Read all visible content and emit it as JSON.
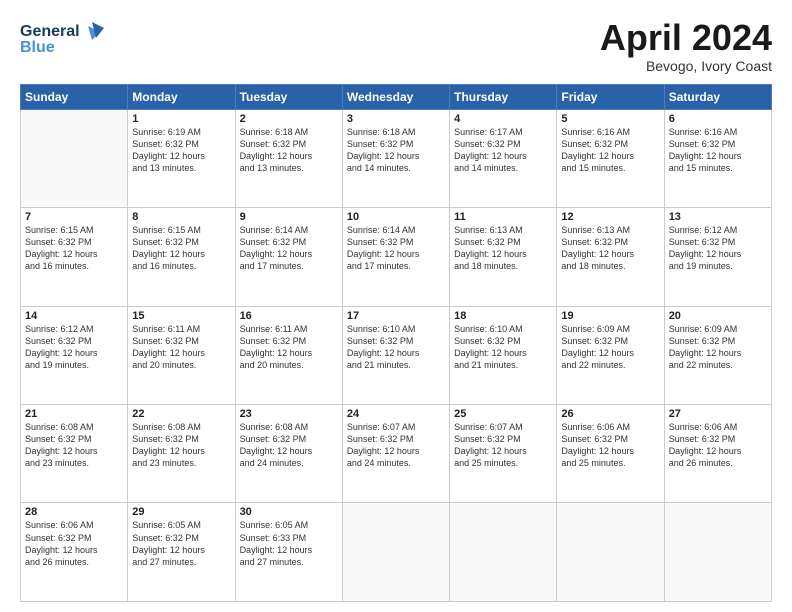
{
  "header": {
    "logo_line1": "General",
    "logo_line2": "Blue",
    "month": "April 2024",
    "location": "Bevogo, Ivory Coast"
  },
  "weekdays": [
    "Sunday",
    "Monday",
    "Tuesday",
    "Wednesday",
    "Thursday",
    "Friday",
    "Saturday"
  ],
  "weeks": [
    [
      {
        "day": "",
        "info": ""
      },
      {
        "day": "1",
        "info": "Sunrise: 6:19 AM\nSunset: 6:32 PM\nDaylight: 12 hours\nand 13 minutes."
      },
      {
        "day": "2",
        "info": "Sunrise: 6:18 AM\nSunset: 6:32 PM\nDaylight: 12 hours\nand 13 minutes."
      },
      {
        "day": "3",
        "info": "Sunrise: 6:18 AM\nSunset: 6:32 PM\nDaylight: 12 hours\nand 14 minutes."
      },
      {
        "day": "4",
        "info": "Sunrise: 6:17 AM\nSunset: 6:32 PM\nDaylight: 12 hours\nand 14 minutes."
      },
      {
        "day": "5",
        "info": "Sunrise: 6:16 AM\nSunset: 6:32 PM\nDaylight: 12 hours\nand 15 minutes."
      },
      {
        "day": "6",
        "info": "Sunrise: 6:16 AM\nSunset: 6:32 PM\nDaylight: 12 hours\nand 15 minutes."
      }
    ],
    [
      {
        "day": "7",
        "info": "Sunrise: 6:15 AM\nSunset: 6:32 PM\nDaylight: 12 hours\nand 16 minutes."
      },
      {
        "day": "8",
        "info": "Sunrise: 6:15 AM\nSunset: 6:32 PM\nDaylight: 12 hours\nand 16 minutes."
      },
      {
        "day": "9",
        "info": "Sunrise: 6:14 AM\nSunset: 6:32 PM\nDaylight: 12 hours\nand 17 minutes."
      },
      {
        "day": "10",
        "info": "Sunrise: 6:14 AM\nSunset: 6:32 PM\nDaylight: 12 hours\nand 17 minutes."
      },
      {
        "day": "11",
        "info": "Sunrise: 6:13 AM\nSunset: 6:32 PM\nDaylight: 12 hours\nand 18 minutes."
      },
      {
        "day": "12",
        "info": "Sunrise: 6:13 AM\nSunset: 6:32 PM\nDaylight: 12 hours\nand 18 minutes."
      },
      {
        "day": "13",
        "info": "Sunrise: 6:12 AM\nSunset: 6:32 PM\nDaylight: 12 hours\nand 19 minutes."
      }
    ],
    [
      {
        "day": "14",
        "info": "Sunrise: 6:12 AM\nSunset: 6:32 PM\nDaylight: 12 hours\nand 19 minutes."
      },
      {
        "day": "15",
        "info": "Sunrise: 6:11 AM\nSunset: 6:32 PM\nDaylight: 12 hours\nand 20 minutes."
      },
      {
        "day": "16",
        "info": "Sunrise: 6:11 AM\nSunset: 6:32 PM\nDaylight: 12 hours\nand 20 minutes."
      },
      {
        "day": "17",
        "info": "Sunrise: 6:10 AM\nSunset: 6:32 PM\nDaylight: 12 hours\nand 21 minutes."
      },
      {
        "day": "18",
        "info": "Sunrise: 6:10 AM\nSunset: 6:32 PM\nDaylight: 12 hours\nand 21 minutes."
      },
      {
        "day": "19",
        "info": "Sunrise: 6:09 AM\nSunset: 6:32 PM\nDaylight: 12 hours\nand 22 minutes."
      },
      {
        "day": "20",
        "info": "Sunrise: 6:09 AM\nSunset: 6:32 PM\nDaylight: 12 hours\nand 22 minutes."
      }
    ],
    [
      {
        "day": "21",
        "info": "Sunrise: 6:08 AM\nSunset: 6:32 PM\nDaylight: 12 hours\nand 23 minutes."
      },
      {
        "day": "22",
        "info": "Sunrise: 6:08 AM\nSunset: 6:32 PM\nDaylight: 12 hours\nand 23 minutes."
      },
      {
        "day": "23",
        "info": "Sunrise: 6:08 AM\nSunset: 6:32 PM\nDaylight: 12 hours\nand 24 minutes."
      },
      {
        "day": "24",
        "info": "Sunrise: 6:07 AM\nSunset: 6:32 PM\nDaylight: 12 hours\nand 24 minutes."
      },
      {
        "day": "25",
        "info": "Sunrise: 6:07 AM\nSunset: 6:32 PM\nDaylight: 12 hours\nand 25 minutes."
      },
      {
        "day": "26",
        "info": "Sunrise: 6:06 AM\nSunset: 6:32 PM\nDaylight: 12 hours\nand 25 minutes."
      },
      {
        "day": "27",
        "info": "Sunrise: 6:06 AM\nSunset: 6:32 PM\nDaylight: 12 hours\nand 26 minutes."
      }
    ],
    [
      {
        "day": "28",
        "info": "Sunrise: 6:06 AM\nSunset: 6:32 PM\nDaylight: 12 hours\nand 26 minutes."
      },
      {
        "day": "29",
        "info": "Sunrise: 6:05 AM\nSunset: 6:32 PM\nDaylight: 12 hours\nand 27 minutes."
      },
      {
        "day": "30",
        "info": "Sunrise: 6:05 AM\nSunset: 6:33 PM\nDaylight: 12 hours\nand 27 minutes."
      },
      {
        "day": "",
        "info": ""
      },
      {
        "day": "",
        "info": ""
      },
      {
        "day": "",
        "info": ""
      },
      {
        "day": "",
        "info": ""
      }
    ]
  ]
}
